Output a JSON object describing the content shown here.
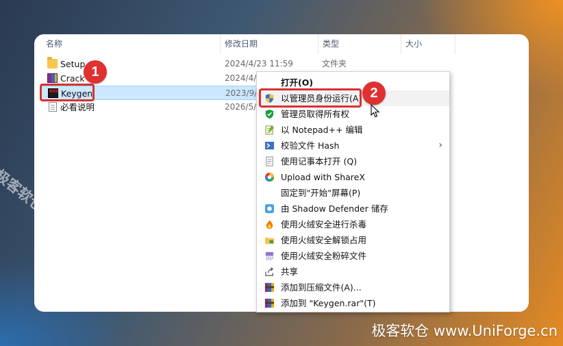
{
  "columns": {
    "name": "名称",
    "date": "修改日期",
    "type": "类型",
    "size": "大小"
  },
  "files": [
    {
      "name": "Setup",
      "date": "2024/4/23 11:59",
      "type": "文件夹",
      "icon": "folder-icon"
    },
    {
      "name": "Crack",
      "date": "2024/4/",
      "type": "",
      "icon": "rar-icon"
    },
    {
      "name": "Keygen",
      "date": "2023/9/",
      "type": "",
      "icon": "keygen-exe-icon",
      "selected": true
    },
    {
      "name": "必看说明",
      "date": "2026/5/",
      "type": "",
      "icon": "text-document-icon"
    }
  ],
  "context_menu": [
    {
      "label": "打开(O)",
      "bold": true,
      "icon": ""
    },
    {
      "label": "以管理员身份运行(A)",
      "icon": "uac-shield-icon",
      "hover": true
    },
    {
      "label": "管理员取得所有权",
      "icon": "green-shield-icon"
    },
    {
      "label": "以 Notepad++ 编辑",
      "icon": "notepadpp-icon"
    },
    {
      "label": "校验文件 Hash",
      "icon": "hash-icon",
      "submenu": true
    },
    {
      "label": "使用记事本打开 (Q)",
      "icon": "notepad-icon"
    },
    {
      "label": "Upload with ShareX",
      "icon": "sharex-icon"
    },
    {
      "label": "固定到\"开始\"屏幕(P)",
      "icon": ""
    },
    {
      "label": "由 Shadow Defender 储存",
      "icon": "shadow-defender-icon"
    },
    {
      "label": "使用火绒安全进行杀毒",
      "icon": "huorong-icon"
    },
    {
      "label": "使用火绒安全解锁占用",
      "icon": "unlock-folder-icon"
    },
    {
      "label": "使用火绒安全粉碎文件",
      "icon": "shredder-icon"
    },
    {
      "label": "共享",
      "icon": "share-icon"
    },
    {
      "label": "添加到压缩文件(A)...",
      "icon": "winrar-icon"
    },
    {
      "label": "添加到 \"Keygen.rar\"(T)",
      "icon": "winrar-icon"
    }
  ],
  "annotations": {
    "step1": "1",
    "step2": "2"
  },
  "watermark": {
    "diagonal": "极客软仓 UniForge.cn",
    "bottom": "极客软仓 www.UniForge.cn"
  },
  "colors": {
    "selection_bg": "#cce8ff",
    "badge_red": "#e03030"
  }
}
